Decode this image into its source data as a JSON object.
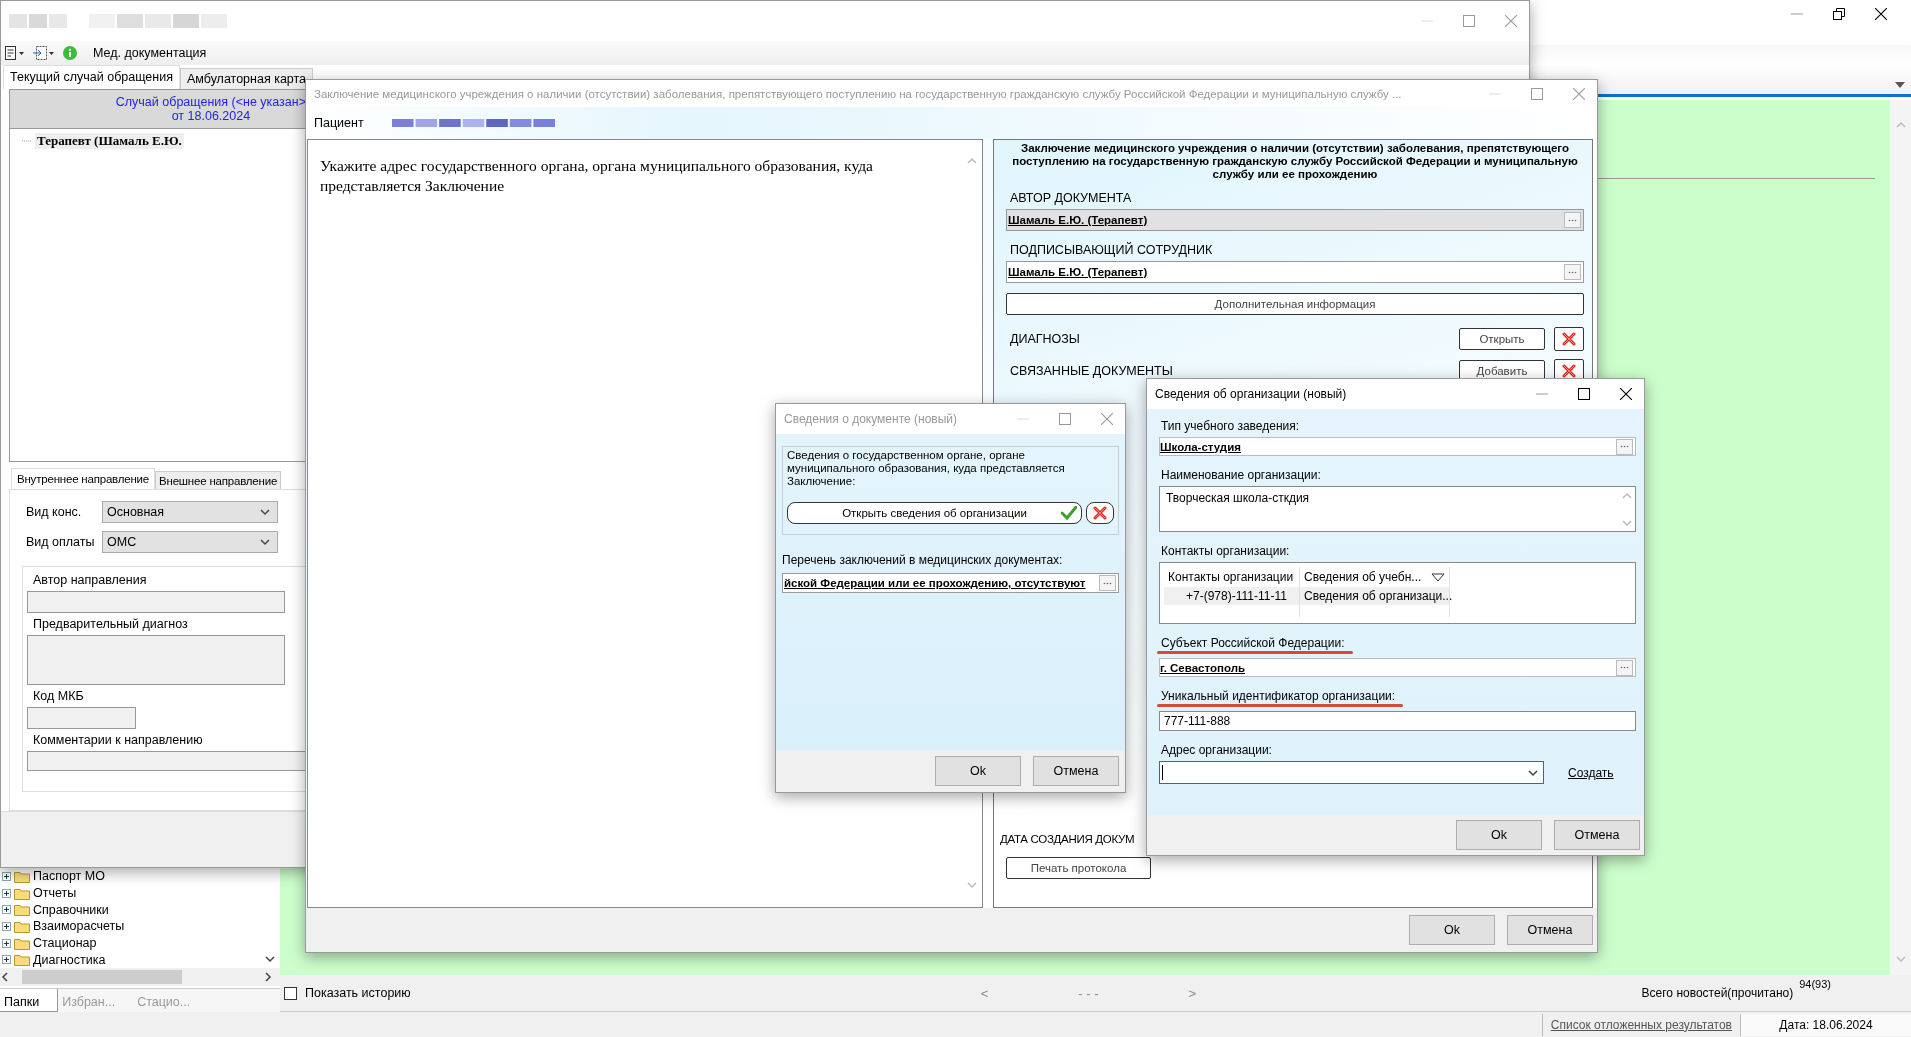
{
  "main_window": {
    "toolbar_label": "Мед. документация",
    "tabs": [
      {
        "label": "Текущий случай обращения",
        "selected": true
      },
      {
        "label": "Амбулаторная карта",
        "selected": false
      }
    ],
    "case_header": {
      "title": "Случай обращения (<не указан>",
      "date": "от 18.06.2024"
    },
    "case_tree": [
      {
        "label": "Терапевт (Шамаль Е.Ю."
      }
    ],
    "referral_tabs": [
      {
        "label": "Внутреннее направление",
        "selected": true
      },
      {
        "label": "Внешнее направление",
        "selected": false
      }
    ],
    "selects": [
      {
        "label": "Вид конс.",
        "value": "Основная"
      },
      {
        "label": "Вид оплаты",
        "value": "ОМС"
      }
    ],
    "referral_fields": [
      {
        "label": "Автор направления",
        "kind": "line"
      },
      {
        "label": "Предварительный диагноз",
        "kind": "area"
      },
      {
        "label": "Код МКБ",
        "kind": "short"
      },
      {
        "label": "Комментарии к направлению",
        "kind": "wide"
      }
    ]
  },
  "conclusion_dialog": {
    "title": "Заключение медицинского учреждения о наличии (отсутствии) заболевания, препятствующего поступлению на государственную гражданскую службу Российской Федерации и муниципальную службу ...",
    "active": false,
    "patient_label": "Пациент",
    "document_text": "Укажите адрес государственного органа, органа муниципального образования, куда представляется Заключение",
    "heading": "Заключение медицинского учреждения о наличии (отсутствии) заболевания, препятствующего поступлению на государственную гражданскую службу Российской Федерации и муниципальную службу или ее прохождению",
    "people": [
      {
        "label": "АВТОР ДОКУМЕНТА",
        "value": "Шамаль Е.Ю. (Терапевт)",
        "disabled": true
      },
      {
        "label": "ПОДПИСЫВАЮЩИЙ СОТРУДНИК",
        "value": "Шамаль Е.Ю. (Терапевт)",
        "disabled": false
      }
    ],
    "info_button": "Дополнительная информация",
    "sections": [
      {
        "label": "ДИАГНОЗЫ",
        "button": "Открыть"
      },
      {
        "label": "СВЯЗАННЫЕ ДОКУМЕНТЫ",
        "button": "Добавить"
      }
    ],
    "date_label": "ДАТА СОЗДАНИЯ ДОКУМ",
    "print_button": "Печать протокола",
    "buttons": [
      "Ok",
      "Отмена"
    ]
  },
  "document_dialog": {
    "title": "Сведения о документе (новый)",
    "active": false,
    "group_text": "Сведения о государственном органе, органе муниципального образования, куда представляется Заключение:",
    "open_button": "Открыть сведения об организации",
    "list_label": "Перечень заключений в медицинских документах:",
    "list_value": "йской Федерации или ее прохождению, отсутствуют",
    "buttons": [
      "Ok",
      "Отмена"
    ]
  },
  "organization_dialog": {
    "title": "Сведения об организации (новый)",
    "active": true,
    "fields": [
      {
        "kind": "lookup",
        "label": "Тип учебного заведения:",
        "value": "Школа-студия",
        "highlighted": false
      },
      {
        "kind": "textarea",
        "label": "Наименование организации:",
        "value": "Творческая школа-сткдия",
        "highlighted": false
      },
      {
        "kind": "grid",
        "label": "Контакты организации:",
        "highlighted": false,
        "columns": [
          "Контакты организации",
          "Сведения об учебн..."
        ],
        "rows": [
          [
            "+7-(978)-111-11-11",
            "Сведения об организаци..."
          ]
        ]
      },
      {
        "kind": "lookup",
        "label": "Субъект Российской Федерации:",
        "value": "г. Севастополь",
        "highlighted": true
      },
      {
        "kind": "text",
        "label": "Уникальный идентификатор организации:",
        "value": "777-111-888",
        "highlighted": true
      },
      {
        "kind": "combo",
        "label": "Адрес организации:",
        "link": "Создать",
        "highlighted": false
      }
    ],
    "buttons": [
      "Ok",
      "Отмена"
    ]
  },
  "folders": [
    {
      "label": "Паспорт МО"
    },
    {
      "label": "Отчеты"
    },
    {
      "label": "Справочники"
    },
    {
      "label": "Взаиморасчеты"
    },
    {
      "label": "Стационар"
    },
    {
      "label": "Диагностика"
    }
  ],
  "folder_tabs": [
    {
      "label": "Папки",
      "selected": true
    },
    {
      "label": "Избран...",
      "selected": false
    },
    {
      "label": "Стацио...",
      "selected": false
    }
  ],
  "news_panel": {
    "history": {
      "label": "Показать историю",
      "checked": false
    },
    "pager": {
      "prev": "<",
      "pages": "- - -",
      "next": ">"
    },
    "news_label": "Всего новостей(прочитано)",
    "news_count": "94(93)"
  },
  "status_bar": {
    "link": "Список отложенных результатов",
    "date": "Дата: 18.06.2024"
  }
}
